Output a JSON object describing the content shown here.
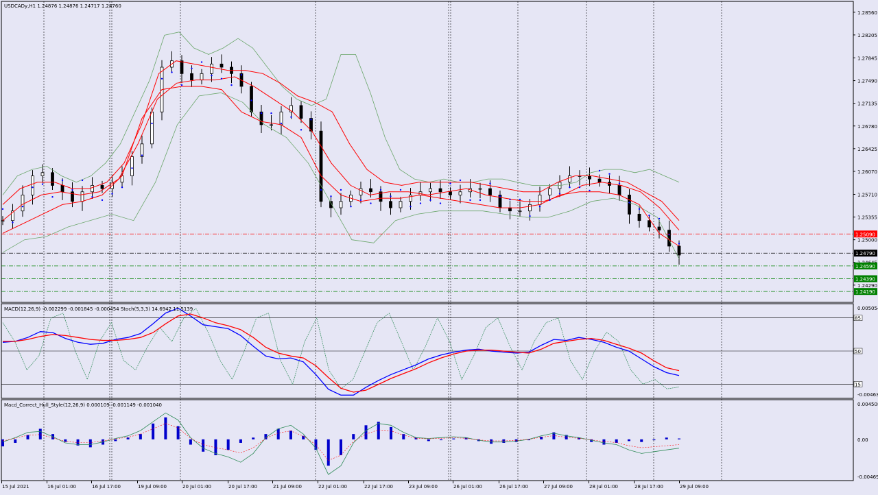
{
  "colors": {
    "background": "#e6e6f5",
    "grid": "#000000",
    "candle": "#000000",
    "bollinger_inner": "#ff0000",
    "bollinger_outer": "#6aa66a",
    "parabolic_sar": "#0000ff",
    "macd_main": "#0000ff",
    "macd_signal": "#ff0000",
    "stoch": "#2e8b57",
    "histogram": "#0000cc",
    "level_red": "#ff0000",
    "level_green": "#008000",
    "level_black": "#000000"
  },
  "chart_data": [
    {
      "type": "candlestick",
      "title": "USDCADy,H1  1.24876 1.24876 1.24717 1.24760",
      "ylim": [
        1.2402,
        1.2873
      ],
      "y_ticks": [
        "1.28560",
        "1.28205",
        "1.27845",
        "1.27490",
        "1.27135",
        "1.26780",
        "1.26425",
        "1.26070",
        "1.25710",
        "1.25355",
        "1.25000",
        "1.24645",
        "1.24290"
      ],
      "x_labels": [
        "15 Jul 2021",
        "16 Jul 01:00",
        "16 Jul 17:00",
        "19 Jul 09:00",
        "20 Jul 01:00",
        "20 Jul 17:00",
        "21 Jul 09:00",
        "22 Jul 01:00",
        "22 Jul 17:00",
        "23 Jul 09:00",
        "26 Jul 01:00",
        "26 Jul 17:00",
        "27 Jul 09:00",
        "28 Jul 01:00",
        "28 Jul 17:00",
        "29 Jul 09:00"
      ],
      "close_series": [
        1.253,
        1.2545,
        1.257,
        1.26,
        1.2605,
        1.2585,
        1.2575,
        1.256,
        1.2575,
        1.2585,
        1.258,
        1.259,
        1.26,
        1.263,
        1.265,
        1.27,
        1.277,
        1.278,
        1.276,
        1.275,
        1.276,
        1.2775,
        1.277,
        1.276,
        1.274,
        1.27,
        1.268,
        1.268,
        1.27,
        1.271,
        1.269,
        1.267,
        1.256,
        1.255,
        1.256,
        1.257,
        1.258,
        1.2575,
        1.256,
        1.255,
        1.256,
        1.257,
        1.2575,
        1.258,
        1.2575,
        1.257,
        1.2575,
        1.258,
        1.258,
        1.257,
        1.255,
        1.2545,
        1.2545,
        1.2555,
        1.257,
        1.258,
        1.259,
        1.26,
        1.26,
        1.2595,
        1.259,
        1.2585,
        1.257,
        1.254,
        1.253,
        1.252,
        1.2515,
        1.249,
        1.2476
      ],
      "bollinger_upper_outer": [
        1.257,
        1.26,
        1.261,
        1.2615,
        1.26,
        1.259,
        1.26,
        1.262,
        1.265,
        1.27,
        1.275,
        1.282,
        1.2825,
        1.28,
        1.279,
        1.28,
        1.2815,
        1.28,
        1.277,
        1.274,
        1.272,
        1.271,
        1.272,
        1.279,
        1.279,
        1.273,
        1.266,
        1.261,
        1.2595,
        1.259,
        1.2595,
        1.259,
        1.259,
        1.2595,
        1.2595,
        1.259,
        1.2585,
        1.2585,
        1.2585,
        1.259,
        1.2605,
        1.261,
        1.261,
        1.2605,
        1.261,
        1.26,
        1.259
      ],
      "bollinger_upper": [
        1.2555,
        1.258,
        1.259,
        1.259,
        1.258,
        1.258,
        1.259,
        1.262,
        1.268,
        1.276,
        1.278,
        1.2775,
        1.277,
        1.2765,
        1.2765,
        1.276,
        1.2745,
        1.2725,
        1.2715,
        1.27,
        1.265,
        1.261,
        1.259,
        1.2585,
        1.259,
        1.259,
        1.259,
        1.259,
        1.2585,
        1.258,
        1.2575,
        1.2575,
        1.259,
        1.26,
        1.26,
        1.2595,
        1.259,
        1.2575,
        1.256,
        1.253
      ],
      "bollinger_middle": [
        1.253,
        1.2555,
        1.257,
        1.2575,
        1.257,
        1.2575,
        1.2595,
        1.265,
        1.272,
        1.2745,
        1.275,
        1.275,
        1.2755,
        1.274,
        1.272,
        1.27,
        1.267,
        1.262,
        1.2585,
        1.257,
        1.2575,
        1.2575,
        1.257,
        1.2575,
        1.258,
        1.257,
        1.2565,
        1.256,
        1.256,
        1.257,
        1.2585,
        1.259,
        1.2585,
        1.2575,
        1.255,
        1.2515
      ],
      "bollinger_lower": [
        1.251,
        1.2525,
        1.254,
        1.2555,
        1.256,
        1.257,
        1.26,
        1.269,
        1.2735,
        1.274,
        1.274,
        1.2735,
        1.27,
        1.2685,
        1.268,
        1.266,
        1.26,
        1.257,
        1.256,
        1.2565,
        1.2565,
        1.257,
        1.2565,
        1.256,
        1.2555,
        1.255,
        1.255,
        1.2555,
        1.257,
        1.2575,
        1.2575,
        1.257,
        1.2555,
        1.251,
        1.249
      ],
      "bollinger_lower_outer": [
        1.248,
        1.25,
        1.2505,
        1.252,
        1.253,
        1.254,
        1.253,
        1.259,
        1.268,
        1.2725,
        1.273,
        1.2715,
        1.268,
        1.266,
        1.262,
        1.256,
        1.25,
        1.2495,
        1.253,
        1.254,
        1.2545,
        1.2545,
        1.2545,
        1.254,
        1.2535,
        1.2535,
        1.2545,
        1.256,
        1.2565,
        1.2555,
        1.2535,
        1.247
      ],
      "horizontal_levels": [
        {
          "price": 1.2509,
          "label": "1.25090",
          "color": "level_red",
          "style": "dashdot"
        },
        {
          "price": 1.2479,
          "label": "1.24790",
          "color": "level_black",
          "style": "dashdot"
        },
        {
          "price": 1.2459,
          "label": "1.24590",
          "color": "level_green",
          "style": "dashdot"
        },
        {
          "price": 1.2439,
          "label": "1.24390",
          "color": "level_green",
          "style": "dashdot"
        },
        {
          "price": 1.2419,
          "label": "1.24190",
          "color": "level_green",
          "style": "dashdot"
        }
      ]
    },
    {
      "type": "line",
      "title": "MACD(12,26,9) -0.002299 -0.001845 -0.000454  Stoch(5,3,3) 14.6942 11.5139",
      "ylim": [
        -0.004633,
        0.005054
      ],
      "y_ticks": [
        "0.005054",
        "-0.004633"
      ],
      "stoch_levels": [
        "85",
        "50",
        "15"
      ],
      "series": [
        {
          "name": "macd_main",
          "values": [
            0.0011,
            0.0012,
            0.0016,
            0.0022,
            0.0021,
            0.0015,
            0.0011,
            0.0009,
            0.001,
            0.0014,
            0.0016,
            0.002,
            0.003,
            0.0041,
            0.0046,
            0.0038,
            0.0029,
            0.0027,
            0.0025,
            0.0018,
            0.0007,
            -0.0003,
            -0.0006,
            -0.0005,
            -0.0009,
            -0.0022,
            -0.0037,
            -0.0043,
            -0.0043,
            -0.0035,
            -0.0028,
            -0.0022,
            -0.0017,
            -0.0012,
            -0.0006,
            -0.0002,
            0.0001,
            0.0003,
            0.0004,
            0.0002,
            0.0001,
            0.0,
            0.0001,
            0.0008,
            0.0014,
            0.0013,
            0.0016,
            0.0014,
            0.0011,
            0.0006,
            0.0002,
            -0.0006,
            -0.0014,
            -0.002,
            -0.0023
          ]
        },
        {
          "name": "macd_signal",
          "values": [
            0.0012,
            0.0012,
            0.0014,
            0.0017,
            0.0019,
            0.0018,
            0.0016,
            0.0014,
            0.0013,
            0.0013,
            0.0014,
            0.0016,
            0.0021,
            0.003,
            0.0038,
            0.004,
            0.0036,
            0.0031,
            0.0028,
            0.0024,
            0.0016,
            0.0006,
            0.0,
            -0.0003,
            -0.0005,
            -0.0013,
            -0.0025,
            -0.0036,
            -0.004,
            -0.0038,
            -0.0032,
            -0.0026,
            -0.0021,
            -0.0016,
            -0.001,
            -0.0005,
            -0.0001,
            0.0002,
            0.0003,
            0.0003,
            0.0002,
            0.0001,
            0.0,
            0.0004,
            0.001,
            0.0012,
            0.0014,
            0.0015,
            0.0013,
            0.0009,
            0.0005,
            0.0,
            -0.0008,
            -0.0015,
            -0.0018
          ]
        },
        {
          "name": "stoch",
          "values": [
            80,
            60,
            30,
            45,
            85,
            90,
            50,
            20,
            60,
            80,
            40,
            30,
            55,
            75,
            60,
            85,
            95,
            70,
            40,
            20,
            50,
            85,
            90,
            40,
            15,
            60,
            85,
            30,
            10,
            20,
            50,
            80,
            90,
            60,
            30,
            55,
            85,
            60,
            20,
            45,
            75,
            85,
            55,
            30,
            60,
            80,
            85,
            40,
            20,
            50,
            70,
            60,
            30,
            15,
            20,
            10,
            12
          ]
        }
      ]
    },
    {
      "type": "bar",
      "title": "Macd_Correct_Hull_Style(12,26,9) 0.000109 -0.001149 -0.001040",
      "ylim": [
        -0.00469,
        0.004508
      ],
      "y_ticks": [
        "0.004508",
        "0.00",
        "-0.00469"
      ],
      "series": [
        {
          "name": "histogram",
          "values": [
            -0.0008,
            -0.0004,
            0.0005,
            0.0012,
            0.0006,
            -0.0003,
            -0.0007,
            -0.0009,
            -0.0006,
            -0.0002,
            0.0002,
            0.0006,
            0.0018,
            0.0025,
            0.0015,
            -0.0006,
            -0.0014,
            -0.0018,
            -0.0012,
            -0.0004,
            0.0002,
            0.0006,
            0.0012,
            0.001,
            0.0004,
            -0.0012,
            -0.003,
            -0.0018,
            0.0006,
            0.0016,
            0.002,
            0.0014,
            0.0006,
            0.0002,
            -0.0002,
            -0.0001,
            0.0001,
            0.0002,
            -0.0002,
            -0.0005,
            -0.0004,
            -0.0003,
            -0.0001,
            0.0003,
            0.0008,
            0.0005,
            0.0002,
            -0.0003,
            -0.0006,
            -0.0004,
            -0.0002,
            -0.0003,
            -0.0001,
            0.0002,
            0.0001
          ]
        },
        {
          "name": "signal",
          "values": [
            -0.0003,
            0.0002,
            0.0008,
            0.0009,
            0.0003,
            -0.0004,
            -0.0006,
            -0.0006,
            -0.0003,
            0.0001,
            0.0004,
            0.001,
            0.002,
            0.003,
            0.0022,
            0.0002,
            -0.001,
            -0.0016,
            -0.002,
            -0.0026,
            -0.0016,
            0.0002,
            0.0012,
            0.0016,
            0.0006,
            -0.001,
            -0.004,
            -0.003,
            -0.0004,
            0.001,
            0.0018,
            0.0016,
            0.0008,
            0.0002,
            0.0001,
            0.0002,
            0.0003,
            0.0002,
            -0.0001,
            -0.0003,
            -0.0003,
            -0.0002,
            0.0,
            0.0004,
            0.0007,
            0.0004,
            0.0002,
            -0.0001,
            -0.0004,
            -0.0006,
            -0.0012,
            -0.0016,
            -0.0014,
            -0.0012,
            -0.001
          ]
        }
      ]
    }
  ]
}
